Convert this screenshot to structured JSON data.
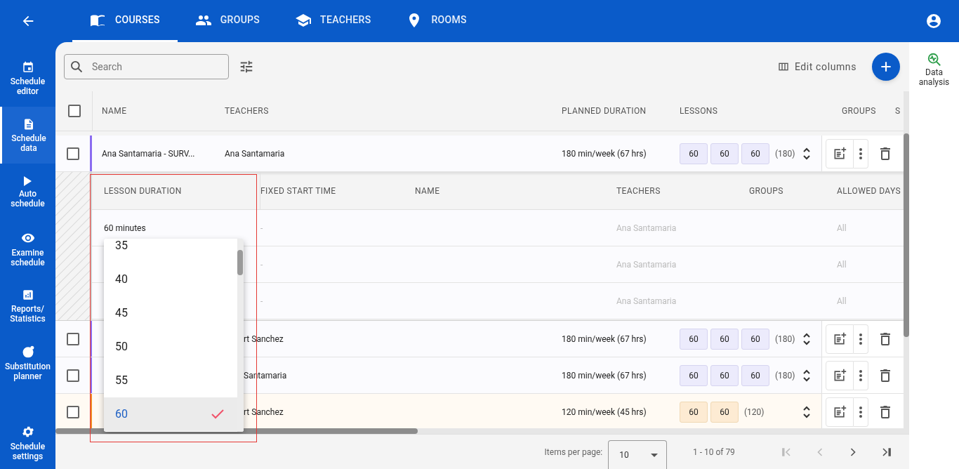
{
  "top_nav": {
    "tabs": [
      {
        "label": "COURSES",
        "selected": true
      },
      {
        "label": "GROUPS",
        "selected": false
      },
      {
        "label": "TEACHERS",
        "selected": false
      },
      {
        "label": "ROOMS",
        "selected": false
      }
    ]
  },
  "sidebar": {
    "items": [
      {
        "label": "Schedule editor",
        "selected": false
      },
      {
        "label": "Schedule data",
        "selected": true
      },
      {
        "label": "Auto schedule",
        "selected": false
      },
      {
        "label": "Examine schedule",
        "selected": false
      },
      {
        "label": "Reports/ Statistics",
        "selected": false
      },
      {
        "label": "Substitution planner",
        "selected": false
      }
    ],
    "settings": {
      "label": "Schedule settings"
    }
  },
  "right_panel": {
    "label": "Data analysis"
  },
  "toolbar": {
    "search": {
      "placeholder": "Search"
    },
    "edit_columns": "Edit columns"
  },
  "table": {
    "header_checked": false,
    "columns": [
      "NAME",
      "TEACHERS",
      "PLANNED DURATION",
      "LESSONS",
      "GROUPS",
      "S"
    ],
    "rows": [
      {
        "name": "Ana Santamaria - SURV...",
        "teachers": "Ana Santamaria",
        "planned": "180 min/week (67 hrs)",
        "lessons": [
          {
            "kind": "chip",
            "label": "60"
          },
          {
            "kind": "chip",
            "label": "60"
          },
          {
            "kind": "chip",
            "label": "60"
          },
          {
            "kind": "total",
            "label": "(180)"
          }
        ],
        "color": "#8b6cf0",
        "checked": false,
        "lesson_details": {
          "columns": [
            "LESSON DURATION",
            "FIXED START TIME",
            "NAME",
            "TEACHERS",
            "GROUPS",
            "ALLOWED DAYS"
          ],
          "rows": [
            {
              "duration": "60 minutes",
              "start": "-",
              "teachers": "Ana Santamaria",
              "days": "All"
            },
            {
              "start": "-",
              "teachers": "Ana Santamaria",
              "days": "All"
            },
            {
              "start": "-",
              "teachers": "Ana Santamaria",
              "days": "All"
            }
          ]
        }
      },
      {
        "teachers": "rt Sanchez",
        "planned": "180 min/week (67 hrs)",
        "lessons": [
          {
            "kind": "chip",
            "label": "60"
          },
          {
            "kind": "chip",
            "label": "60"
          },
          {
            "kind": "chip",
            "label": "60"
          },
          {
            "kind": "total",
            "label": "(180)"
          }
        ],
        "color": "#8b6cf0",
        "checked": false
      },
      {
        "teachers": "Santamaria",
        "planned": "180 min/week (67 hrs)",
        "lessons": [
          {
            "kind": "chip",
            "label": "60"
          },
          {
            "kind": "chip",
            "label": "60"
          },
          {
            "kind": "chip",
            "label": "60"
          },
          {
            "kind": "total",
            "label": "(180)"
          }
        ],
        "color": "#8b6cf0",
        "checked": false
      },
      {
        "teachers": "rt Sanchez",
        "planned": "120 min/week (45 hrs)",
        "lessons": [
          {
            "kind": "chip",
            "label": "60"
          },
          {
            "kind": "chip",
            "label": "60"
          },
          {
            "kind": "total",
            "label": "(120)"
          }
        ],
        "color": "#f08a24",
        "checked": false
      }
    ]
  },
  "duration_dropdown": {
    "options": [
      {
        "label": "35",
        "selected": false
      },
      {
        "label": "40",
        "selected": false
      },
      {
        "label": "45",
        "selected": false
      },
      {
        "label": "50",
        "selected": false
      },
      {
        "label": "55",
        "selected": false
      },
      {
        "label": "60",
        "selected": true
      }
    ]
  },
  "pagination": {
    "label": "Items per page:",
    "page_size": "10",
    "range": "1 - 10 of 79"
  }
}
